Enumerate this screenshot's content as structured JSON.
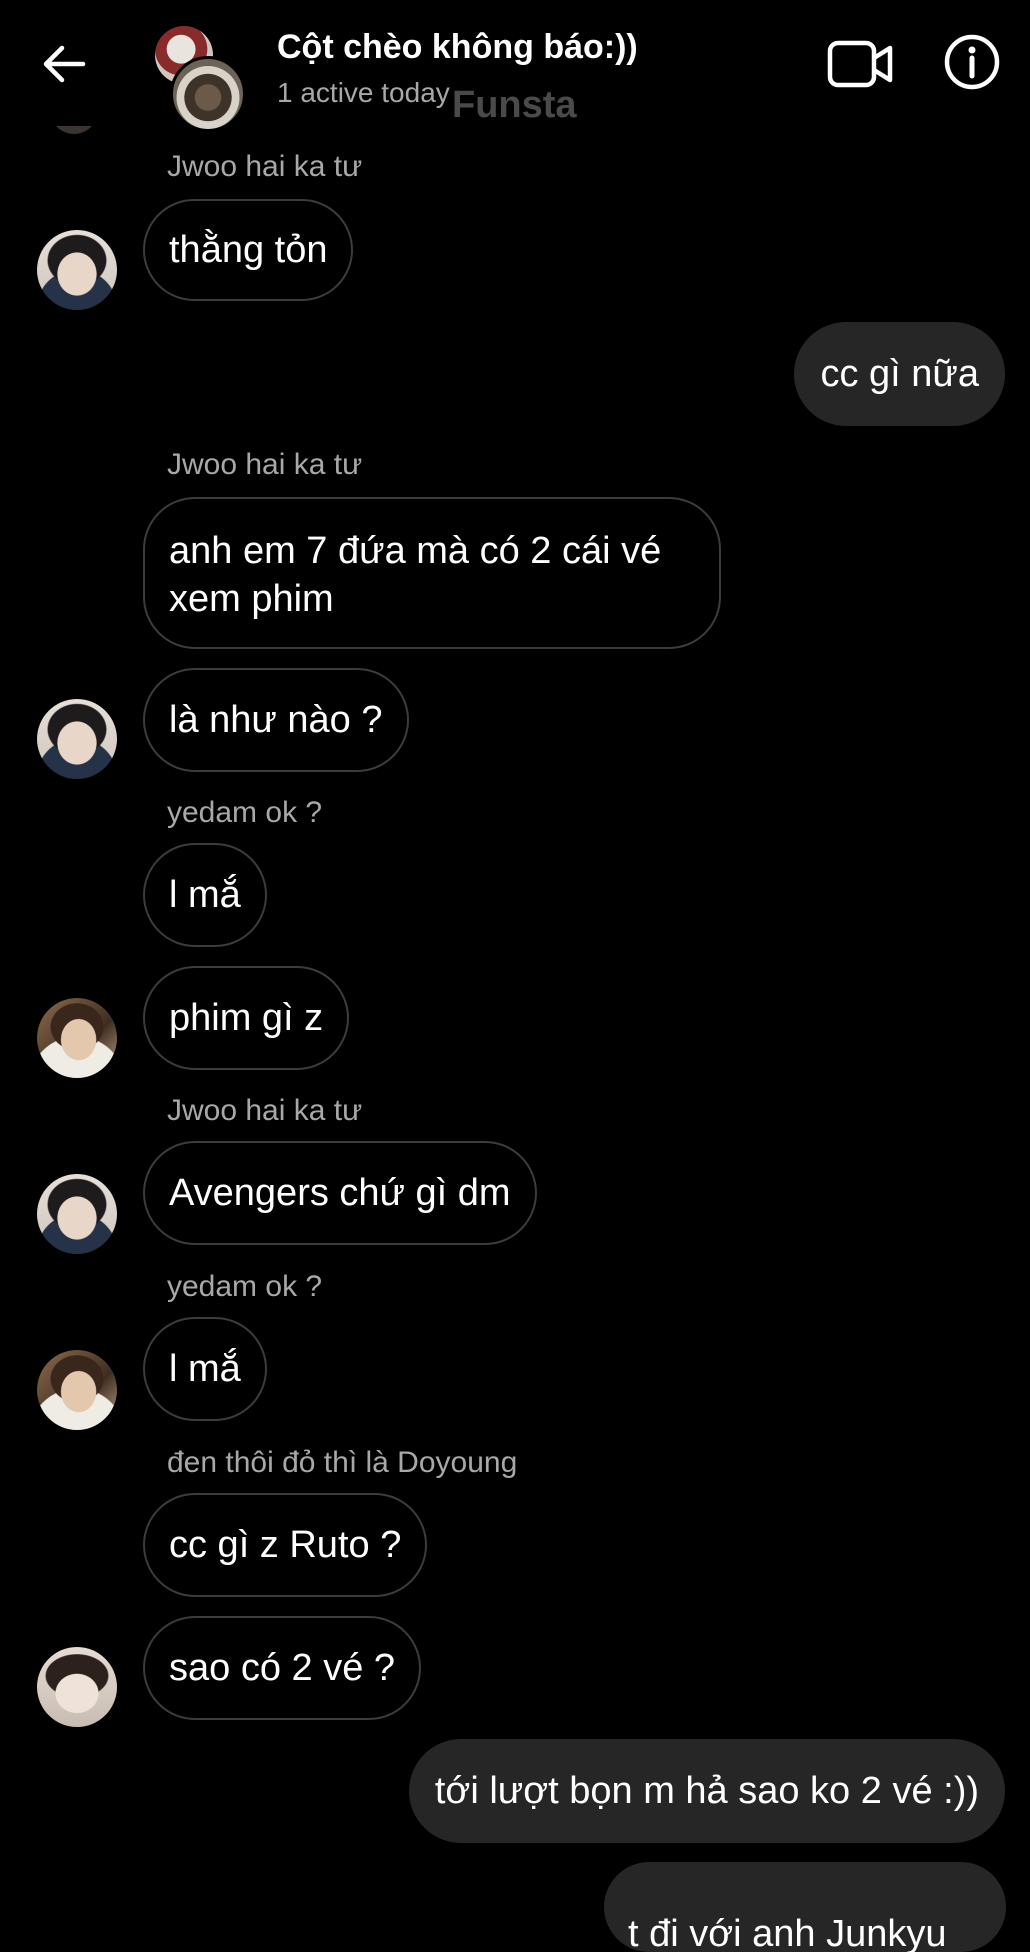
{
  "header": {
    "title": "Cột chèo không báo:))",
    "subtitle": "1 active today",
    "watermark": "Funsta",
    "back_icon": "arrow-left-icon",
    "video_icon": "video-camera-icon",
    "info_icon": "info-circle-icon"
  },
  "messages": [
    {
      "type": "sender",
      "text": "Jwoo hai ka tư"
    },
    {
      "type": "in",
      "text": "thằng tỏn",
      "avatar": "jwoo"
    },
    {
      "type": "out",
      "text": "cc gì nữa"
    },
    {
      "type": "sender",
      "text": "Jwoo hai ka tư"
    },
    {
      "type": "in",
      "text": "anh em 7 đứa mà có 2 cái vé xem phim"
    },
    {
      "type": "in",
      "text": "là như nào ?",
      "avatar": "jwoo"
    },
    {
      "type": "sender",
      "text": "yedam ok ?"
    },
    {
      "type": "in",
      "text": "l mắ"
    },
    {
      "type": "in",
      "text": "phim gì z",
      "avatar": "yedam"
    },
    {
      "type": "sender",
      "text": "Jwoo hai ka tư"
    },
    {
      "type": "in",
      "text": "Avengers chứ gì dm",
      "avatar": "jwoo"
    },
    {
      "type": "sender",
      "text": "yedam ok ?"
    },
    {
      "type": "in",
      "text": "l mắ",
      "avatar": "yedam"
    },
    {
      "type": "sender",
      "text": "đen thôi đỏ thì là Doyoung"
    },
    {
      "type": "in",
      "text": "cc gì z Ruto ?"
    },
    {
      "type": "in",
      "text": "sao có 2 vé ?",
      "avatar": "doyoung"
    },
    {
      "type": "out",
      "text": "tới lượt bọn m hả sao ko 2 vé :))"
    },
    {
      "type": "out-partial",
      "text": "t đi với anh Junkyu"
    }
  ],
  "colors": {
    "background": "#000000",
    "bubble_out": "#262626",
    "bubble_in_border": "#3c3c3c",
    "muted_text": "#a8a8a8"
  }
}
